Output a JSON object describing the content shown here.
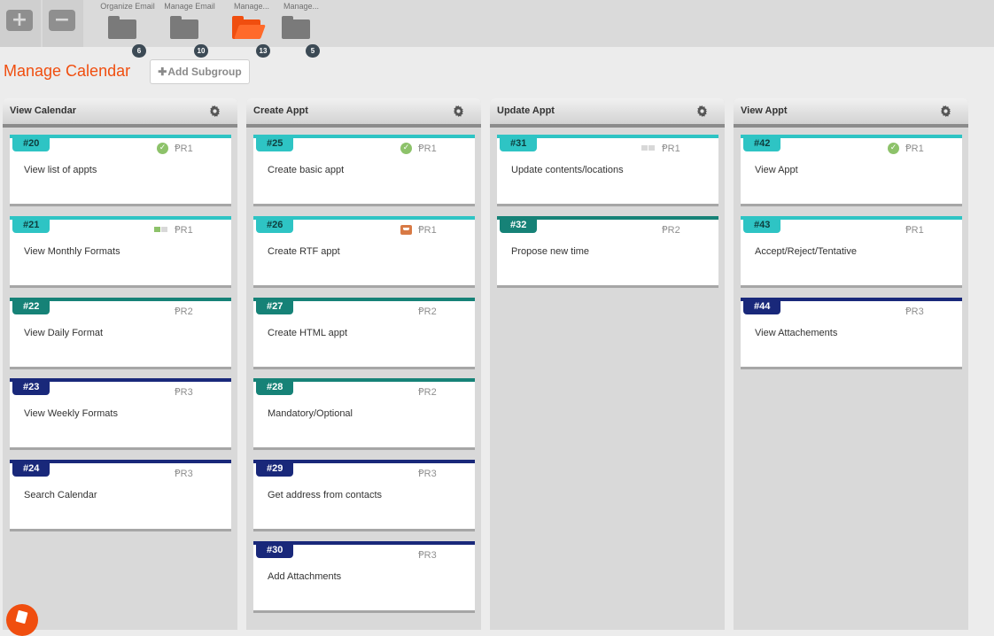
{
  "toolbar": {
    "add_label": "+",
    "remove_label": "−",
    "tabs": [
      {
        "label": "Organize Email",
        "count": "6",
        "active": false
      },
      {
        "label": "Manage Email",
        "count": "10",
        "active": false
      },
      {
        "label": "Manage...",
        "count": "13",
        "active": true
      },
      {
        "label": "Manage...",
        "count": "5",
        "active": false
      }
    ]
  },
  "page": {
    "title": "Manage Calendar",
    "add_subgroup_label": "Add Subgroup"
  },
  "columns": [
    {
      "title": "View Calendar",
      "cards": [
        {
          "id": "#20",
          "title": "View list of appts",
          "priority": "R1",
          "status": "check"
        },
        {
          "id": "#21",
          "title": "View Monthly Formats",
          "priority": "R1",
          "status": "bars-partial"
        },
        {
          "id": "#22",
          "title": "View Daily Format",
          "priority": "R2",
          "status": ""
        },
        {
          "id": "#23",
          "title": "View Weekly Formats",
          "priority": "R3",
          "status": ""
        },
        {
          "id": "#24",
          "title": "Search Calendar",
          "priority": "R3",
          "status": ""
        }
      ]
    },
    {
      "title": "Create Appt",
      "cards": [
        {
          "id": "#25",
          "title": "Create basic appt",
          "priority": "R1",
          "status": "check"
        },
        {
          "id": "#26",
          "title": "Create RTF appt",
          "priority": "R1",
          "status": "inbox"
        },
        {
          "id": "#27",
          "title": "Create HTML appt",
          "priority": "R2",
          "status": ""
        },
        {
          "id": "#28",
          "title": "Mandatory/Optional",
          "priority": "R2",
          "status": ""
        },
        {
          "id": "#29",
          "title": "Get address from contacts",
          "priority": "R3",
          "status": ""
        },
        {
          "id": "#30",
          "title": "Add Attachments",
          "priority": "R3",
          "status": ""
        }
      ]
    },
    {
      "title": "Update Appt",
      "cards": [
        {
          "id": "#31",
          "title": "Update contents/locations",
          "priority": "R1",
          "status": "bars-empty"
        },
        {
          "id": "#32",
          "title": "Propose new time",
          "priority": "R2",
          "status": ""
        }
      ]
    },
    {
      "title": "View Appt",
      "cards": [
        {
          "id": "#42",
          "title": "View Appt",
          "priority": "R1",
          "status": "check"
        },
        {
          "id": "#43",
          "title": "Accept/Reject/Tentative",
          "priority": "R1",
          "status": ""
        },
        {
          "id": "#44",
          "title": "View Attachements",
          "priority": "R3",
          "status": ""
        }
      ]
    }
  ],
  "colors": {
    "accent": "#f04e0f",
    "r1": "#2ec4c4",
    "r2": "#168277",
    "r3": "#19287a",
    "check": "#8dc26a"
  }
}
